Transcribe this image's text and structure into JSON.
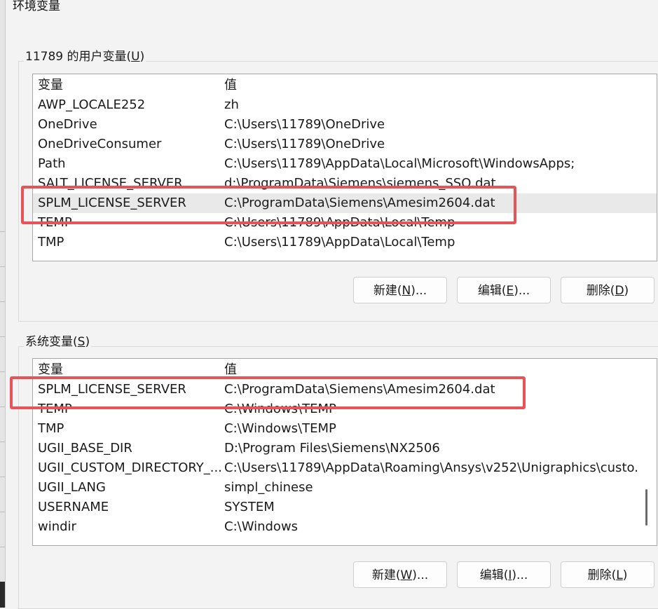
{
  "window_title": "环境变量",
  "user_section": {
    "label_prefix": "11789 的用户变量(",
    "label_key": "U",
    "label_suffix": ")",
    "columns": [
      "变量",
      "值"
    ],
    "rows": [
      {
        "name": "AWP_LOCALE252",
        "value": "zh"
      },
      {
        "name": "OneDrive",
        "value": "C:\\Users\\11789\\OneDrive"
      },
      {
        "name": "OneDriveConsumer",
        "value": "C:\\Users\\11789\\OneDrive"
      },
      {
        "name": "Path",
        "value": "C:\\Users\\11789\\AppData\\Local\\Microsoft\\WindowsApps;"
      },
      {
        "name": "SALT_LICENSE_SERVER",
        "value": "d:\\ProgramData\\Siemens\\siemens_SSQ.dat"
      },
      {
        "name": "SPLM_LICENSE_SERVER",
        "value": "C:\\ProgramData\\Siemens\\Amesim2604.dat"
      },
      {
        "name": "TEMP",
        "value": "C:\\Users\\11789\\AppData\\Local\\Temp"
      },
      {
        "name": "TMP",
        "value": "C:\\Users\\11789\\AppData\\Local\\Temp"
      }
    ],
    "selected_index": 5,
    "buttons": {
      "new": {
        "pre": "新建(",
        "key": "N",
        "post": ")..."
      },
      "edit": {
        "pre": "编辑(",
        "key": "E",
        "post": ")..."
      },
      "delete": {
        "pre": "删除(",
        "key": "D",
        "post": ")"
      }
    }
  },
  "system_section": {
    "label_prefix": "系统变量(",
    "label_key": "S",
    "label_suffix": ")",
    "columns": [
      "变量",
      "值"
    ],
    "rows": [
      {
        "name": "SPLM_LICENSE_SERVER",
        "value": "C:\\ProgramData\\Siemens\\Amesim2604.dat"
      },
      {
        "name": "TEMP",
        "value": "C:\\Windows\\TEMP"
      },
      {
        "name": "TMP",
        "value": "C:\\Windows\\TEMP"
      },
      {
        "name": "UGII_BASE_DIR",
        "value": "D:\\Program Files\\Siemens\\NX2506"
      },
      {
        "name": "UGII_CUSTOM_DIRECTORY_...",
        "value": "C:\\Users\\11789\\AppData\\Roaming\\Ansys\\v252\\Unigraphics\\custo..."
      },
      {
        "name": "UGII_LANG",
        "value": "simpl_chinese"
      },
      {
        "name": "USERNAME",
        "value": "SYSTEM"
      },
      {
        "name": "windir",
        "value": "C:\\Windows"
      }
    ],
    "buttons": {
      "new": {
        "pre": "新建(",
        "key": "W",
        "post": ")..."
      },
      "edit": {
        "pre": "编辑(",
        "key": "I",
        "post": ")..."
      },
      "delete": {
        "pre": "删除(",
        "key": "L",
        "post": ")"
      }
    }
  },
  "colors": {
    "highlight_border": "#e6545a",
    "selected_row": "#e9e9e9"
  }
}
